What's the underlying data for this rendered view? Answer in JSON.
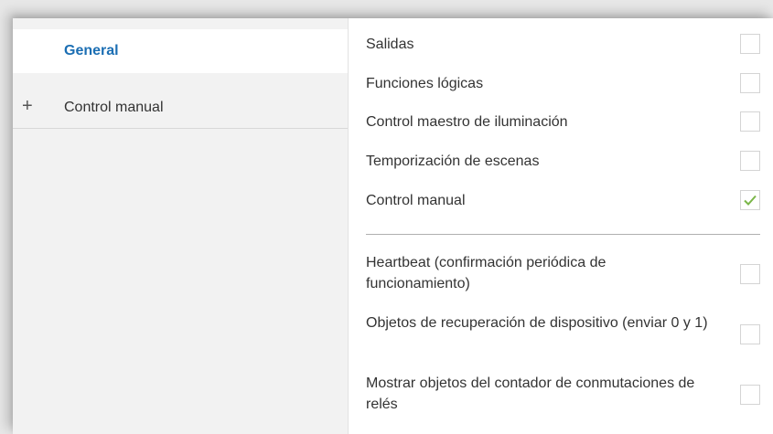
{
  "sidebar": {
    "items": [
      {
        "label": "General",
        "selected": true
      },
      {
        "label": "Control manual",
        "expander": "+"
      }
    ]
  },
  "options": [
    {
      "label": "Salidas",
      "checked": false
    },
    {
      "label": "Funciones lógicas",
      "checked": false
    },
    {
      "label": "Control maestro de iluminación",
      "checked": false
    },
    {
      "label": "Temporización de escenas",
      "checked": false
    },
    {
      "label": "Control manual",
      "checked": true
    }
  ],
  "extra_options": [
    {
      "label": "Heartbeat (confirmación periódica de funcionamiento)",
      "checked": false
    },
    {
      "label": "Objetos de recuperación de dispositivo (enviar 0 y 1)",
      "checked": false
    },
    {
      "label": "Mostrar objetos del contador de conmutaciones de relés",
      "checked": false
    }
  ],
  "colors": {
    "accent": "#1b6eb3",
    "check": "#7ab648"
  }
}
